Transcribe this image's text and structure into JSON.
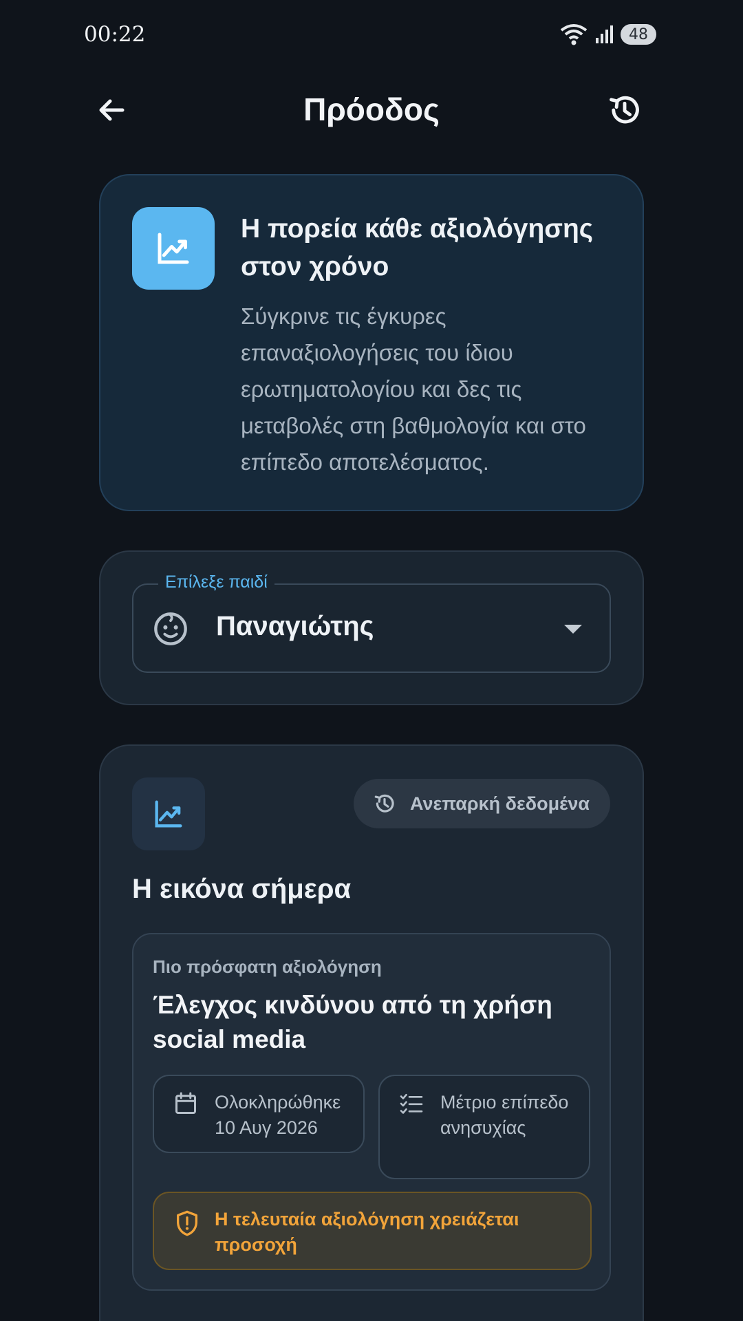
{
  "status_bar": {
    "time": "00:22",
    "battery": "48"
  },
  "app_bar": {
    "title": "Πρόοδος"
  },
  "intro": {
    "title": "Η πορεία κάθε αξιολόγησης στον χρόνο",
    "description": "Σύγκρινε τις έγκυρες επαναξιολογήσεις του ίδιου ερωτηματολογίου και δες τις μεταβολές στη βαθμολογία και στο επίπεδο αποτελέσματος."
  },
  "child_select": {
    "label": "Επίλεξε παιδί",
    "value": "Παναγιώτης"
  },
  "today": {
    "chip": "Ανεπαρκή δεδομένα",
    "title": "Η εικόνα σήμερα",
    "latest": {
      "overline": "Πιο πρόσφατη αξιολόγηση",
      "title": "Έλεγχος κινδύνου από τη χρήση social media",
      "completed": "Ολοκληρώθηκε 10 Αυγ 2026",
      "level": "Μέτριο επίπεδο ανησυχίας",
      "alert": "Η τελευταία αξιολόγηση χρειάζεται προσοχή"
    }
  },
  "colors": {
    "accent": "#5bb7f0",
    "warning": "#f2a43a",
    "background": "#0f141b"
  }
}
